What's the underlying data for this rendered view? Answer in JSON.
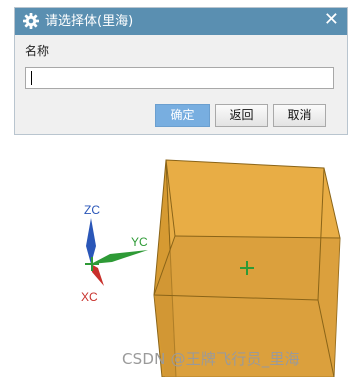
{
  "dialog": {
    "title": "请选择体(里海)",
    "close_glyph": "✕",
    "field_label": "名称",
    "name_value": "",
    "buttons": {
      "ok": "确定",
      "back": "返回",
      "cancel": "取消"
    }
  },
  "axes": {
    "z_label": "ZC",
    "y_label": "YC",
    "x_label": "XC"
  },
  "colors": {
    "title_bar": "#5a8fb1",
    "ok_button": "#78aee0",
    "box_face": "#e3a53c",
    "axis_z": "#2a56b8",
    "axis_y": "#2e9a36",
    "axis_x": "#c8302b"
  },
  "icons": {
    "title": "gear-icon",
    "close": "close-icon",
    "center_marker": "plus-marker"
  },
  "watermark": "CSDN @王牌飞行员_里海"
}
